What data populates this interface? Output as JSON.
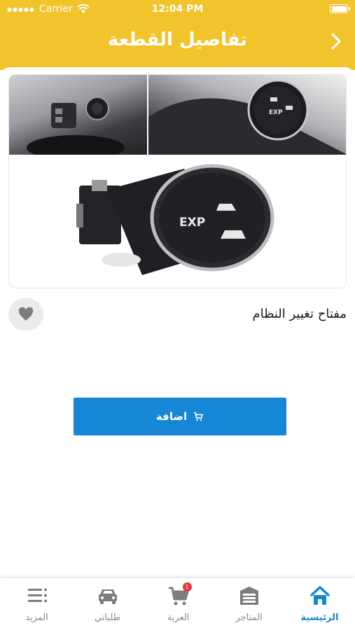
{
  "status_bar": {
    "carrier": "Carrier",
    "time": "12:04 PM"
  },
  "header": {
    "title": "تفاصيل القطعة"
  },
  "product": {
    "name": "مفتاح تغيير النظام",
    "image_text": "EXP"
  },
  "actions": {
    "add_label": "اضافة"
  },
  "tabbar": {
    "cart_badge": "1",
    "items": [
      {
        "label": "الرئيسية",
        "icon": "home-icon",
        "active": true
      },
      {
        "label": "المتاجر",
        "icon": "store-icon"
      },
      {
        "label": "العربة",
        "icon": "cart-icon"
      },
      {
        "label": "طلباتي",
        "icon": "car-icon"
      },
      {
        "label": "المزيد",
        "icon": "more-icon"
      }
    ]
  },
  "colors": {
    "header": "#f2c42c",
    "accent": "#1686d6",
    "inactive": "#8a8a8a",
    "badge": "#e53935"
  }
}
